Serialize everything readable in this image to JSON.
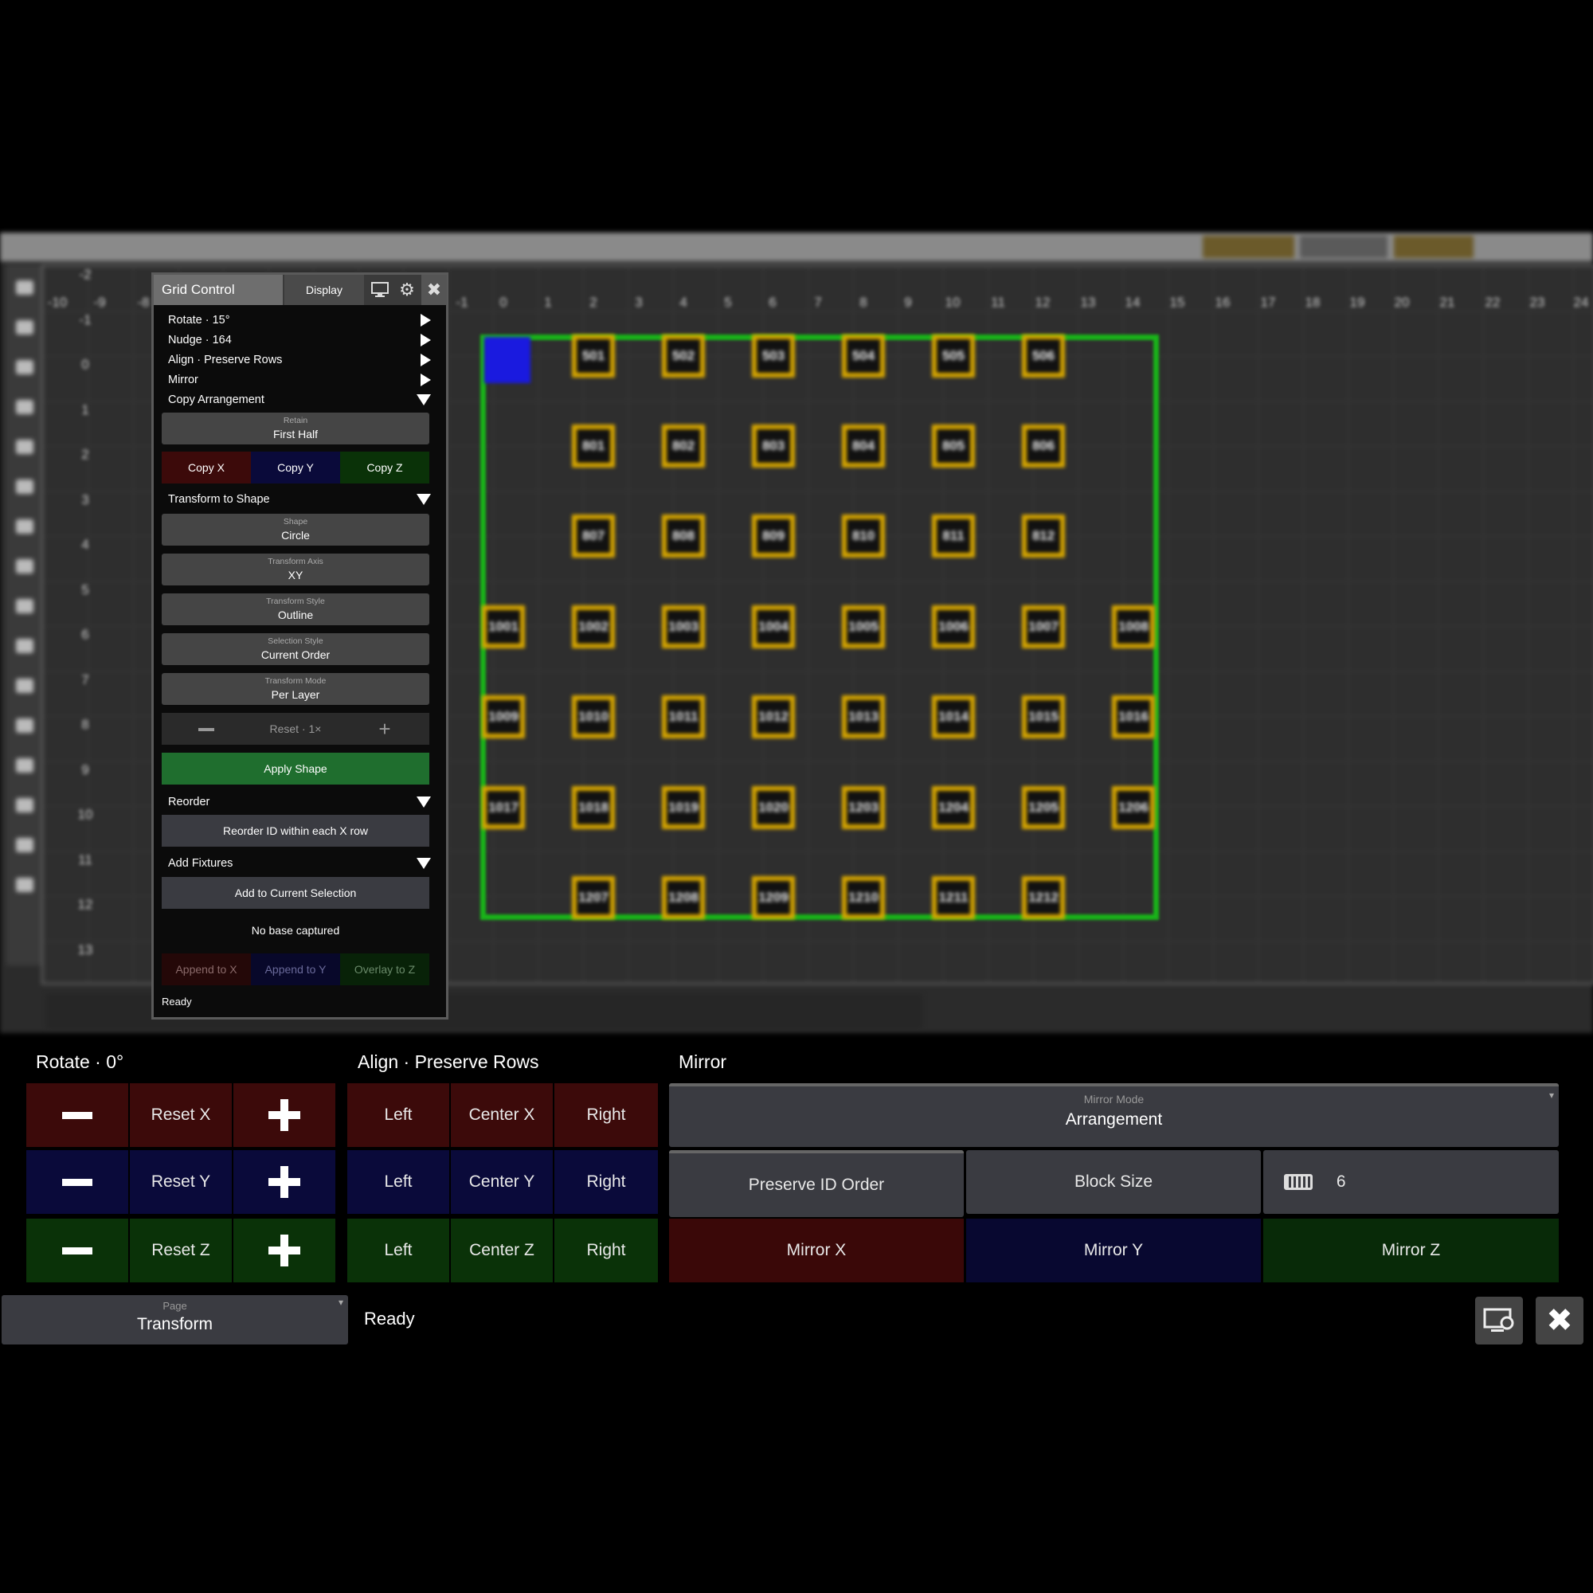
{
  "grid": {
    "x_ticks": [
      "-10",
      "-9",
      "-8",
      "-1",
      "0",
      "1",
      "2",
      "3",
      "4",
      "5",
      "6",
      "7",
      "8",
      "9",
      "10",
      "11",
      "12",
      "13",
      "14",
      "15",
      "16",
      "17",
      "18",
      "19",
      "20",
      "21",
      "22",
      "23",
      "24"
    ],
    "y_ticks": [
      "-2",
      "-1",
      "0",
      "1",
      "2",
      "3",
      "4",
      "5",
      "6",
      "7",
      "8",
      "9",
      "10",
      "11",
      "12",
      "13"
    ],
    "fixtures": [
      "501",
      "502",
      "503",
      "504",
      "505",
      "506",
      "801",
      "802",
      "803",
      "804",
      "805",
      "806",
      "807",
      "808",
      "809",
      "810",
      "811",
      "812",
      "1001",
      "1002",
      "1003",
      "1004",
      "1005",
      "1006",
      "1007",
      "1008",
      "1009",
      "1010",
      "1011",
      "1012",
      "1013",
      "1014",
      "1015",
      "1016",
      "1017",
      "1018",
      "1019",
      "1020",
      "1203",
      "1204",
      "1205",
      "1206",
      "1207",
      "1208",
      "1209",
      "1210",
      "1211",
      "1212"
    ],
    "colors": {
      "selection": "#19b319",
      "fixture_border": "#d9a800",
      "cursor": "#1a1adf"
    }
  },
  "panel": {
    "title": "Grid Control",
    "display_tab": "Display",
    "icons": [
      "monitor-icon",
      "gear-icon",
      "close-icon"
    ],
    "rotate": "Rotate · 15°",
    "nudge": "Nudge · 164",
    "align": "Align · Preserve Rows",
    "mirror": "Mirror",
    "copy_arrangement": "Copy Arrangement",
    "retain": {
      "label": "Retain",
      "value": "First Half"
    },
    "copy_x": "Copy X",
    "copy_y": "Copy Y",
    "copy_z": "Copy Z",
    "transform_to_shape": "Transform to Shape",
    "shape": {
      "label": "Shape",
      "value": "Circle"
    },
    "transform_axis": {
      "label": "Transform Axis",
      "value": "XY"
    },
    "transform_style": {
      "label": "Transform Style",
      "value": "Outline"
    },
    "selection_style": {
      "label": "Selection Style",
      "value": "Current Order"
    },
    "transform_mode": {
      "label": "Transform Mode",
      "value": "Per Layer"
    },
    "reset": "Reset · 1×",
    "apply_shape": "Apply Shape",
    "reorder": "Reorder",
    "reorder_btn": "Reorder ID within each X row",
    "add_fixtures": "Add Fixtures",
    "add_to_selection": "Add to Current Selection",
    "no_base": "No base captured",
    "append_x": "Append to X",
    "append_y": "Append to Y",
    "overlay_z": "Overlay to Z",
    "status": "Ready"
  },
  "bottom": {
    "rotate_header": "Rotate · 0°",
    "reset_x": "Reset X",
    "reset_y": "Reset Y",
    "reset_z": "Reset Z",
    "align_header": "Align · Preserve Rows",
    "left": "Left",
    "right": "Right",
    "center_x": "Center X",
    "center_y": "Center Y",
    "center_z": "Center Z",
    "mirror_header": "Mirror",
    "mirror_mode": {
      "label": "Mirror Mode",
      "value": "Arrangement"
    },
    "preserve_id": "Preserve ID Order",
    "block_size": "Block Size",
    "block_value": "6",
    "mirror_x": "Mirror X",
    "mirror_y": "Mirror Y",
    "mirror_z": "Mirror Z",
    "page": {
      "label": "Page",
      "value": "Transform"
    },
    "status": "Ready"
  }
}
